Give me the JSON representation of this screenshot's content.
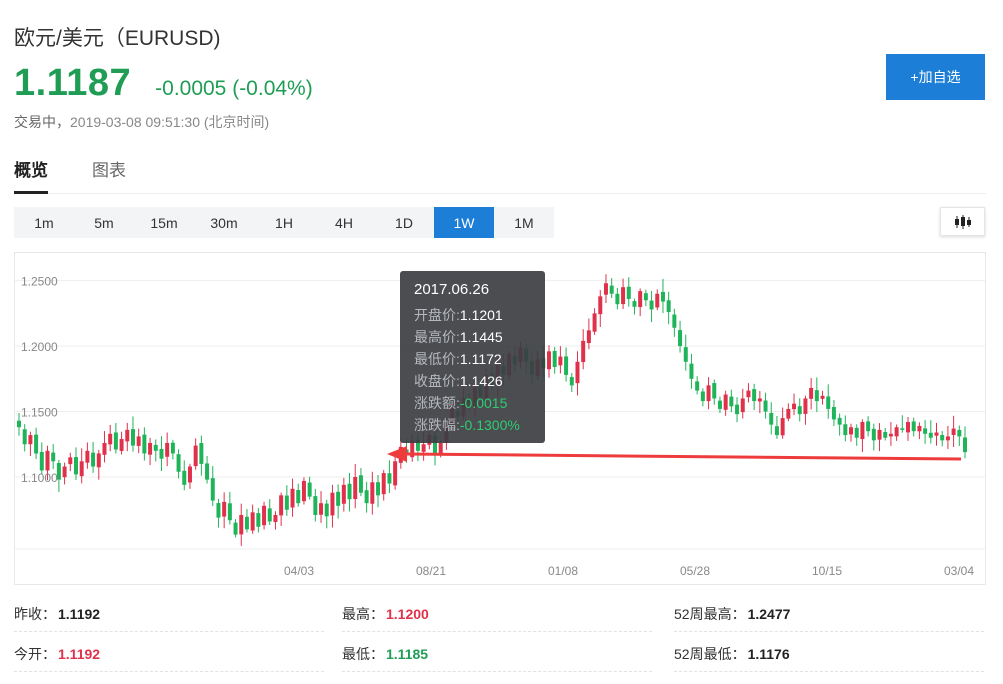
{
  "header": {
    "title": "欧元/美元（EURUSD)",
    "price": "1.1187",
    "change": "-0.0005 (-0.04%)",
    "status_label": "交易中，",
    "status_time": "2019-03-08 09:51:30 (北京时间)",
    "add_button": "+加自选"
  },
  "tabs": [
    {
      "label": "概览",
      "active": true
    },
    {
      "label": "图表",
      "active": false
    }
  ],
  "periods": [
    "1m",
    "5m",
    "15m",
    "30m",
    "1H",
    "4H",
    "1D",
    "1W",
    "1M"
  ],
  "active_period": "1W",
  "chart_type_icon": "candlestick-icon",
  "colors": {
    "up": "#e0314b",
    "down": "#1fb45a",
    "accent": "#1c7ed6",
    "arrow": "#ee3b3b"
  },
  "tooltip": {
    "date": "2017.06.26",
    "open_label": "开盘价:",
    "open": "1.1201",
    "high_label": "最高价:",
    "high": "1.1445",
    "low_label": "最低价:",
    "low": "1.1172",
    "close_label": "收盘价:",
    "close": "1.1426",
    "chg_label": "涨跌额:",
    "chg": "-0.0015",
    "pct_label": "涨跌幅:",
    "pct": "-0.1300%"
  },
  "chart_data": {
    "type": "candlestick",
    "y_ticks": [
      "1.2500",
      "1.2000",
      "1.1500",
      "1.1000"
    ],
    "y_tick_values": [
      1.25,
      1.2,
      1.15,
      1.1
    ],
    "ylim": [
      1.045,
      1.265
    ],
    "x_ticks": [
      "04/03",
      "08/21",
      "01/08",
      "05/28",
      "10/15",
      "03/04"
    ],
    "grid": true,
    "closes": [
      1.138,
      1.125,
      1.132,
      1.118,
      1.105,
      1.12,
      1.112,
      1.098,
      1.108,
      1.115,
      1.102,
      1.112,
      1.12,
      1.108,
      1.118,
      1.126,
      1.133,
      1.121,
      1.129,
      1.136,
      1.124,
      1.131,
      1.118,
      1.126,
      1.12,
      1.114,
      1.126,
      1.118,
      1.104,
      1.094,
      1.108,
      1.124,
      1.11,
      1.098,
      1.082,
      1.069,
      1.081,
      1.067,
      1.056,
      1.071,
      1.06,
      1.073,
      1.062,
      1.078,
      1.066,
      1.071,
      1.086,
      1.075,
      1.091,
      1.08,
      1.097,
      1.085,
      1.071,
      1.08,
      1.07,
      1.088,
      1.078,
      1.094,
      1.083,
      1.1,
      1.088,
      1.08,
      1.096,
      1.086,
      1.103,
      1.095,
      1.112,
      1.123,
      1.117,
      1.128,
      1.12,
      1.125,
      1.132,
      1.118,
      1.126,
      1.14,
      1.152,
      1.146,
      1.16,
      1.156,
      1.168,
      1.161,
      1.178,
      1.17,
      1.185,
      1.178,
      1.194,
      1.186,
      1.199,
      1.188,
      1.178,
      1.19,
      1.183,
      1.196,
      1.184,
      1.192,
      1.178,
      1.17,
      1.188,
      1.204,
      1.212,
      1.225,
      1.238,
      1.248,
      1.24,
      1.232,
      1.245,
      1.236,
      1.23,
      1.242,
      1.235,
      1.228,
      1.24,
      1.234,
      1.226,
      1.214,
      1.2,
      1.188,
      1.175,
      1.166,
      1.158,
      1.17,
      1.16,
      1.152,
      1.163,
      1.154,
      1.148,
      1.16,
      1.166,
      1.158,
      1.16,
      1.15,
      1.14,
      1.132,
      1.145,
      1.152,
      1.156,
      1.148,
      1.16,
      1.168,
      1.158,
      1.162,
      1.152,
      1.144,
      1.14,
      1.132,
      1.138,
      1.13,
      1.142,
      1.135,
      1.128,
      1.136,
      1.13,
      1.133,
      1.138,
      1.136,
      1.142,
      1.135,
      1.139,
      1.133,
      1.13,
      1.134,
      1.128,
      1.131,
      1.137,
      1.131,
      1.119
    ]
  },
  "stats": [
    {
      "label": "昨收：",
      "value": "1.1192",
      "color": "black"
    },
    {
      "label": "最高：",
      "value": "1.1200",
      "color": "red"
    },
    {
      "label": "52周最高：",
      "value": "1.2477",
      "color": "black"
    },
    {
      "label": "今开：",
      "value": "1.1192",
      "color": "red"
    },
    {
      "label": "最低：",
      "value": "1.1185",
      "color": "green"
    },
    {
      "label": "52周最低：",
      "value": "1.1176",
      "color": "black"
    }
  ]
}
